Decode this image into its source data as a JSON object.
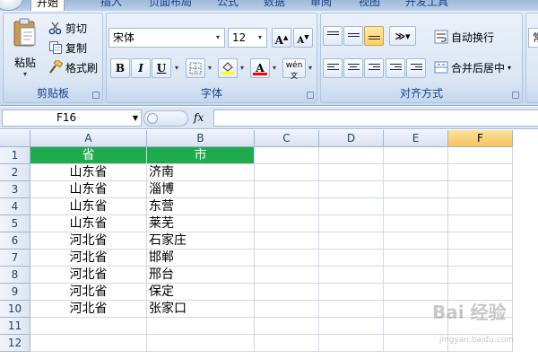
{
  "ribbon": {
    "tabs": [
      "开始",
      "插入",
      "页面布局",
      "公式",
      "数据",
      "审阅",
      "视图",
      "开发工具"
    ],
    "clipboard": {
      "paste": "粘贴",
      "cut": "剪切",
      "copy": "复制",
      "format_painter": "格式刷",
      "label": "剪贴板"
    },
    "font": {
      "name": "宋体",
      "size": "12",
      "bold": "B",
      "italic": "I",
      "underline": "U",
      "font_color_glyph": "A",
      "wen": "wén",
      "label": "字体"
    },
    "alignment": {
      "wrap_text": "自动换行",
      "merge_center": "合并后居中",
      "label": "对齐方式"
    },
    "number": {
      "format": "常"
    },
    "colors": {
      "highlight": "#ffff00",
      "font_color": "#ff0000"
    }
  },
  "formula_bar": {
    "name_box": "F16",
    "fx": "fx",
    "content": ""
  },
  "sheet": {
    "columns": [
      "A",
      "B",
      "C",
      "D",
      "E",
      "F"
    ],
    "selected_column": "F",
    "rows": [
      "1",
      "2",
      "3",
      "4",
      "5",
      "6",
      "7",
      "8",
      "9",
      "10",
      "11",
      "12"
    ],
    "header_fill": "#1faa4e",
    "data": [
      [
        "省",
        "市"
      ],
      [
        "山东省",
        "济南"
      ],
      [
        "山东省",
        "淄博"
      ],
      [
        "山东省",
        "东营"
      ],
      [
        "山东省",
        "莱芜"
      ],
      [
        "河北省",
        "石家庄"
      ],
      [
        "河北省",
        "邯郸"
      ],
      [
        "河北省",
        "邢台"
      ],
      [
        "河北省",
        "保定"
      ],
      [
        "河北省",
        "张家口"
      ]
    ]
  },
  "watermark": {
    "text": "Bai 经验",
    "url": "jingyan.baidu.com"
  }
}
